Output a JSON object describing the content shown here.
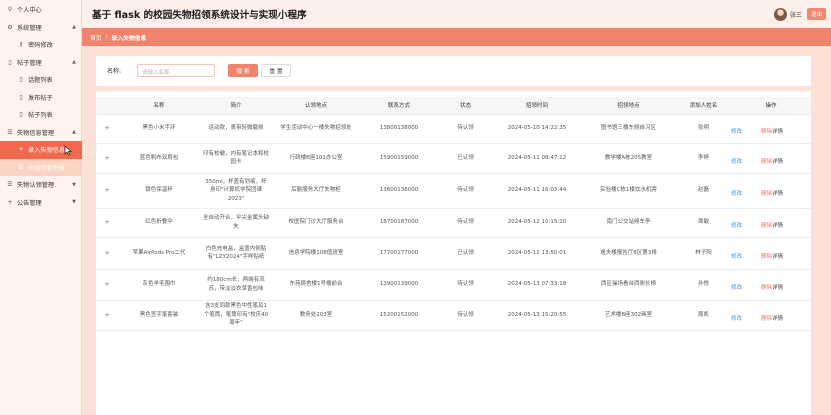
{
  "header": {
    "app_title": "基于 flask 的校园失物招领系统设计与实现小程序",
    "user_name": "张三",
    "logout_label": "退出"
  },
  "sidebar": {
    "items": [
      {
        "label": "个人中心",
        "icon": "person-icon",
        "level": 0,
        "arrow": ""
      },
      {
        "label": "系统管理",
        "icon": "gear-icon",
        "level": 0,
        "arrow": "▲"
      },
      {
        "label": "密码修改",
        "icon": "key-icon",
        "level": 1,
        "arrow": ""
      },
      {
        "label": "帖子管理",
        "icon": "doc-icon",
        "level": 0,
        "arrow": "▲"
      },
      {
        "label": "话题列表",
        "icon": "doc-icon",
        "level": 1,
        "arrow": ""
      },
      {
        "label": "发布帖子",
        "icon": "doc-icon",
        "level": 1,
        "arrow": ""
      },
      {
        "label": "帖子列表",
        "icon": "doc-icon",
        "level": 1,
        "arrow": ""
      },
      {
        "label": "失物信息管理",
        "icon": "list-icon",
        "level": 0,
        "arrow": "▲"
      },
      {
        "label": "录入失物信息",
        "icon": "plus-icon",
        "level": 1,
        "arrow": "",
        "state": "active"
      },
      {
        "label": "失物信息列表",
        "icon": "list-icon",
        "level": 1,
        "arrow": "",
        "state": "hover"
      },
      {
        "label": "失物认领管理",
        "icon": "list-icon",
        "level": 0,
        "arrow": "▼"
      },
      {
        "label": "公告管理",
        "icon": "plus-icon",
        "level": 0,
        "arrow": "▼"
      }
    ]
  },
  "breadcrumb": {
    "home": "首页",
    "sep": "/",
    "current": "录入失物信息"
  },
  "search": {
    "label": "名称:",
    "placeholder": "请输入名称",
    "search_label": "搜 索",
    "reset_label": "重 置"
  },
  "table": {
    "headers": [
      "",
      "名称",
      "简介",
      "认领地点",
      "联系方式",
      "状态",
      "招领时间",
      "招领地点",
      "添加人姓名",
      "操作"
    ],
    "edit_label": "修改",
    "delete_label": "删除",
    "detail_label": "详情",
    "rows": [
      {
        "name": "黑色小米手环",
        "desc": "运动款，表带轻微磨损",
        "claim_place": "学生活动中心一楼失物招领处",
        "contact": "13800138000",
        "status": "待认领",
        "time": "2024-05-10 14:22:35",
        "found_place": "图书馆三楼东侧自习区",
        "adder": "张明"
      },
      {
        "name": "蓝色帆布双肩包",
        "desc": "印有校徽，内有笔记本和校园卡",
        "claim_place": "行政楼B座101办公室",
        "contact": "15900159000",
        "status": "已认领",
        "time": "2024-05-11 08:47:12",
        "found_place": "教学楼A栋205教室",
        "adder": "李婷"
      },
      {
        "name": "银色保温杯",
        "desc": "350ml，杯盖有划痕，杯身印\"计算机学院团课2023\"",
        "claim_place": "后勤服务大厅失物柜",
        "contact": "13600136000",
        "status": "待认领",
        "time": "2024-05-11 16:03:44",
        "found_place": "实验楼C栋1楼饮水机旁",
        "adder": "赵磊"
      },
      {
        "name": "红色折叠伞",
        "desc": "全自动开合，伞尖金属头缺失",
        "claim_place": "校医院门诊大厅服务台",
        "contact": "18700187000",
        "status": "待认领",
        "time": "2024-05-12 10:15:20",
        "found_place": "南门公交站候车亭",
        "adder": "周敏"
      },
      {
        "name": "苹果AirPods Pro二代",
        "desc": "白色充电盒，盒盖内侧贴有\"LZY2024\"字样贴纸",
        "claim_place": "信息学院楼108值班室",
        "contact": "17700177000",
        "status": "已认领",
        "time": "2024-05-12 13:50:01",
        "found_place": "逸夫楼报告厅8区第3排",
        "adder": "林子阳"
      },
      {
        "name": "灰色羊毛围巾",
        "desc": "约180cm长，两端有流苏，带淡淡衣草香包味",
        "claim_place": "东苑宿舍楼1号楼前台",
        "contact": "13900139000",
        "status": "待认领",
        "time": "2024-05-13 07:33:18",
        "found_place": "西区操场看台西侧长椅",
        "adder": "孙悦"
      },
      {
        "name": "黑色签字笔套装",
        "desc": "含3支同款黑色中性笔及1个笔筒，笔筒印有\"校庆40周年\"",
        "claim_place": "教务处203室",
        "contact": "15200152000",
        "status": "待认领",
        "time": "2024-05-13 15:20:55",
        "found_place": "艺术楼B座302画室",
        "adder": "周凯"
      }
    ]
  }
}
